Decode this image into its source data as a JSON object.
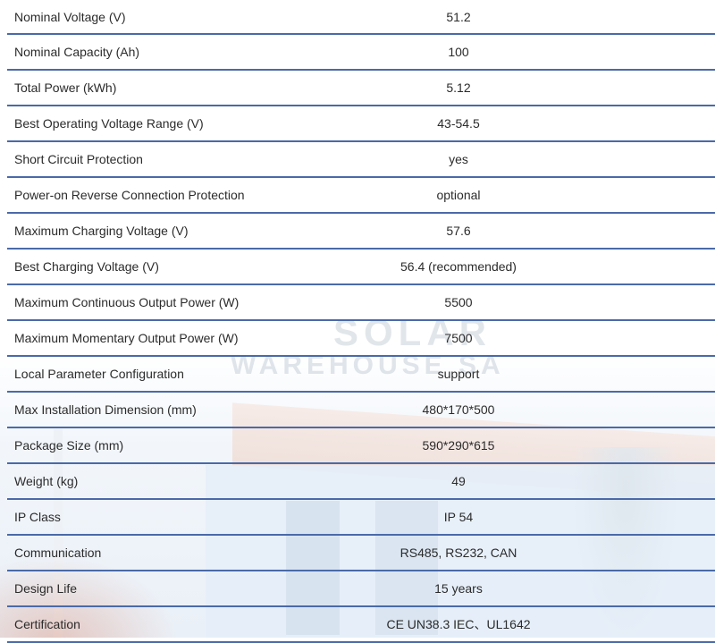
{
  "rows": [
    {
      "label": "Nominal Voltage (V)",
      "value": "51.2"
    },
    {
      "label": "Nominal Capacity (Ah)",
      "value": "100"
    },
    {
      "label": "Total Power (kWh)",
      "value": "5.12"
    },
    {
      "label": "Best Operating Voltage Range (V)",
      "value": "43-54.5"
    },
    {
      "label": "Short Circuit Protection",
      "value": "yes"
    },
    {
      "label": "Power-on Reverse Connection Protection",
      "value": "optional"
    },
    {
      "label": "Maximum Charging Voltage (V)",
      "value": "57.6"
    },
    {
      "label": "Best Charging Voltage (V)",
      "value": "56.4 (recommended)"
    },
    {
      "label": "Maximum Continuous Output Power (W)",
      "value": "5500"
    },
    {
      "label": "Maximum Momentary Output Power (W)",
      "value": "7500"
    },
    {
      "label": "Local Parameter Configuration",
      "value": "support"
    },
    {
      "label": "Max Installation Dimension (mm)",
      "value": "480*170*500"
    },
    {
      "label": "Package Size (mm)",
      "value": "590*290*615"
    },
    {
      "label": "Weight (kg)",
      "value": "49"
    },
    {
      "label": "IP Class",
      "value": "IP 54"
    },
    {
      "label": "Communication",
      "value": "RS485, RS232, CAN"
    },
    {
      "label": "Design Life",
      "value": "15 years"
    },
    {
      "label": "Certification",
      "value": "CE UN38.3 IEC、UL1642"
    }
  ],
  "watermark": {
    "line1": "SOLAR",
    "line2": "WAREHOUSE SA"
  },
  "colors": {
    "row_divider": "#4a6aa8",
    "text": "#2b2b2b"
  }
}
